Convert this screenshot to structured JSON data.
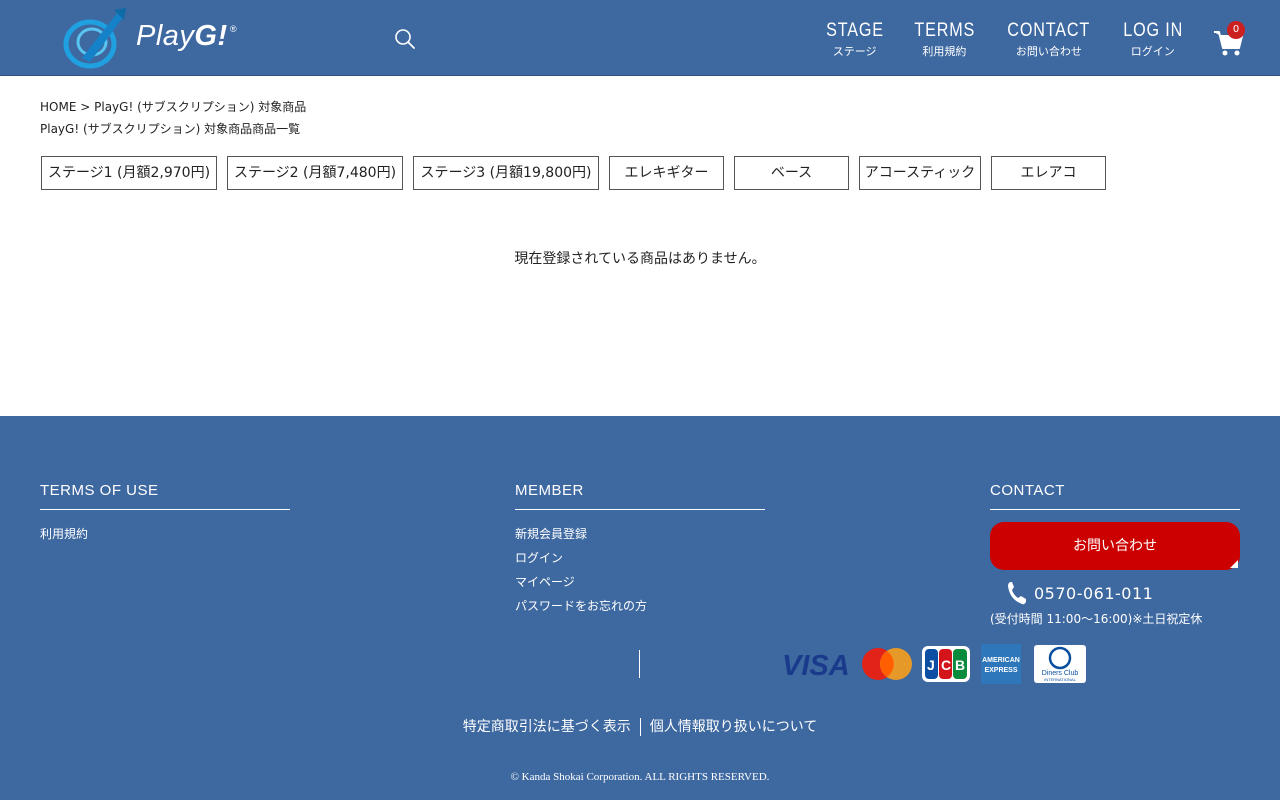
{
  "header": {
    "logo_prefix": "Play",
    "logo_bold": "G!",
    "logo_mark": "®",
    "nav": [
      {
        "main": "STAGE",
        "sub": "ステージ"
      },
      {
        "main": "TERMS",
        "sub": "利用規約"
      },
      {
        "main": "CONTACT",
        "sub": "お問い合わせ"
      },
      {
        "main": "LOG IN",
        "sub": "ログイン"
      }
    ],
    "cart_count": "0"
  },
  "breadcrumb": {
    "home": "HOME",
    "separator": ">",
    "current": "PlayG! (サブスクリプション) 対象商品",
    "page_title": "PlayG! (サブスクリプション) 対象商品商品一覧"
  },
  "categories": [
    "ステージ1 (月額2,970円)",
    "ステージ2 (月額7,480円)",
    "ステージ3 (月額19,800円)",
    "エレキギター",
    "ベース",
    "アコースティック",
    "エレアコ"
  ],
  "empty_message": "現在登録されている商品はありません。",
  "footer": {
    "terms": {
      "heading": "TERMS OF USE",
      "links": [
        "利用規約"
      ]
    },
    "member": {
      "heading": "MEMBER",
      "links": [
        "新規会員登録",
        "ログイン",
        "マイページ",
        "パスワードをお忘れの方"
      ]
    },
    "contact": {
      "heading": "CONTACT",
      "button": "お問い合わせ",
      "phone": "0570-061-011",
      "hours": "(受付時間 11:00〜16:00)※土日祝定休"
    },
    "card_brands": [
      "VISA",
      "Mastercard",
      "JCB",
      "AMERICAN EXPRESS",
      "Diners Club INTERNATIONAL"
    ],
    "legal_links": [
      "特定商取引法に基づく表示",
      "個人情報取り扱いについて"
    ],
    "copyright": "© Kanda Shokai Corporation. ALL RIGHTS RESERVED."
  },
  "colors": {
    "brand_blue": "#3e68a0",
    "accent_red": "#cc0000"
  }
}
